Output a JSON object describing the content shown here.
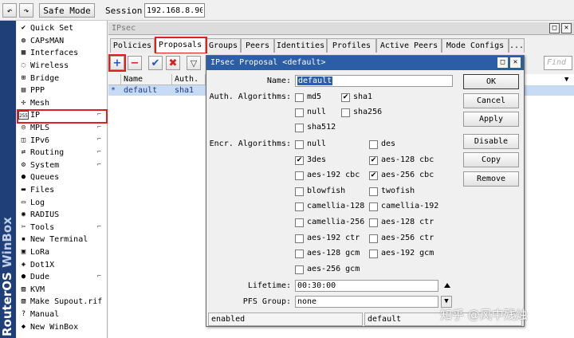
{
  "topbar": {
    "undo_icon": "undo-arrow-icon",
    "redo_icon": "redo-arrow-icon",
    "safe_mode_label": "Safe Mode",
    "session_label": "Session:",
    "session_value": "192.168.8.90"
  },
  "brand": {
    "part1": "RouterOS",
    "part2": " WinBox"
  },
  "sidebar": {
    "items": [
      {
        "label": "Quick Set",
        "icon": "✔",
        "arrow": ""
      },
      {
        "label": "CAPsMAN",
        "icon": "◍",
        "arrow": ""
      },
      {
        "label": "Interfaces",
        "icon": "▦",
        "arrow": ""
      },
      {
        "label": "Wireless",
        "icon": "◌",
        "arrow": ""
      },
      {
        "label": "Bridge",
        "icon": "⊞",
        "arrow": ""
      },
      {
        "label": "PPP",
        "icon": "▤",
        "arrow": ""
      },
      {
        "label": "Mesh",
        "icon": "✣",
        "arrow": ""
      },
      {
        "label": "IP",
        "icon": "255",
        "arrow": "⌐"
      },
      {
        "label": "MPLS",
        "icon": "◎",
        "arrow": "⌐"
      },
      {
        "label": "IPv6",
        "icon": "◫",
        "arrow": "⌐"
      },
      {
        "label": "Routing",
        "icon": "⇄",
        "arrow": "⌐"
      },
      {
        "label": "System",
        "icon": "⚙",
        "arrow": "⌐"
      },
      {
        "label": "Queues",
        "icon": "●",
        "arrow": ""
      },
      {
        "label": "Files",
        "icon": "▬",
        "arrow": ""
      },
      {
        "label": "Log",
        "icon": "▭",
        "arrow": ""
      },
      {
        "label": "RADIUS",
        "icon": "◉",
        "arrow": ""
      },
      {
        "label": "Tools",
        "icon": "✂",
        "arrow": "⌐"
      },
      {
        "label": "New Terminal",
        "icon": "▪",
        "arrow": ""
      },
      {
        "label": "LoRa",
        "icon": "▣",
        "arrow": ""
      },
      {
        "label": "Dot1X",
        "icon": "◈",
        "arrow": ""
      },
      {
        "label": "Dude",
        "icon": "●",
        "arrow": "⌐"
      },
      {
        "label": "KVM",
        "icon": "▨",
        "arrow": ""
      },
      {
        "label": "Make Supout.rif",
        "icon": "▧",
        "arrow": ""
      },
      {
        "label": "Manual",
        "icon": "?",
        "arrow": ""
      },
      {
        "label": "New WinBox",
        "icon": "◆",
        "arrow": ""
      }
    ]
  },
  "ipsec": {
    "title": "IPsec",
    "tabs": [
      "Policies",
      "Proposals",
      "Groups",
      "Peers",
      "Identities",
      "Profiles",
      "Active Peers",
      "Mode Configs",
      "..."
    ],
    "find_placeholder": "Find",
    "columns": [
      "Name",
      "Auth."
    ],
    "rows": [
      {
        "marker": "*",
        "name": "default",
        "auth": "sha1"
      }
    ]
  },
  "dialog": {
    "title": "IPsec Proposal <default>",
    "name_label": "Name:",
    "name_value": "default",
    "auth_label": "Auth. Algorithms:",
    "auth_algorithms": [
      {
        "label": "md5",
        "checked": false
      },
      {
        "label": "sha1",
        "checked": true
      },
      {
        "label": "null",
        "checked": false
      },
      {
        "label": "sha256",
        "checked": false
      },
      {
        "label": "sha512",
        "checked": false
      }
    ],
    "encr_label": "Encr. Algorithms:",
    "encr_algorithms": [
      {
        "label": "null",
        "checked": false
      },
      {
        "label": "des",
        "checked": false
      },
      {
        "label": "3des",
        "checked": true
      },
      {
        "label": "aes-128 cbc",
        "checked": true
      },
      {
        "label": "aes-192 cbc",
        "checked": false
      },
      {
        "label": "aes-256 cbc",
        "checked": true
      },
      {
        "label": "blowfish",
        "checked": false
      },
      {
        "label": "twofish",
        "checked": false
      },
      {
        "label": "camellia-128",
        "checked": false
      },
      {
        "label": "camellia-192",
        "checked": false
      },
      {
        "label": "camellia-256",
        "checked": false
      },
      {
        "label": "aes-128 ctr",
        "checked": false
      },
      {
        "label": "aes-192 ctr",
        "checked": false
      },
      {
        "label": "aes-256 ctr",
        "checked": false
      },
      {
        "label": "aes-128 gcm",
        "checked": false
      },
      {
        "label": "aes-192 gcm",
        "checked": false
      },
      {
        "label": "aes-256 gcm",
        "checked": false
      }
    ],
    "lifetime_label": "Lifetime:",
    "lifetime_value": "00:30:00",
    "pfs_label": "PFS Group:",
    "pfs_value": "none",
    "buttons": {
      "ok": "OK",
      "cancel": "Cancel",
      "apply": "Apply",
      "disable": "Disable",
      "copy": "Copy",
      "remove": "Remove"
    },
    "status_left": "enabled",
    "status_right": "default"
  },
  "watermark": "知乎 @风中残烛",
  "colors": {
    "accent": "#2c5ea8",
    "highlight": "#e02020",
    "brand": "#1f3f78"
  }
}
